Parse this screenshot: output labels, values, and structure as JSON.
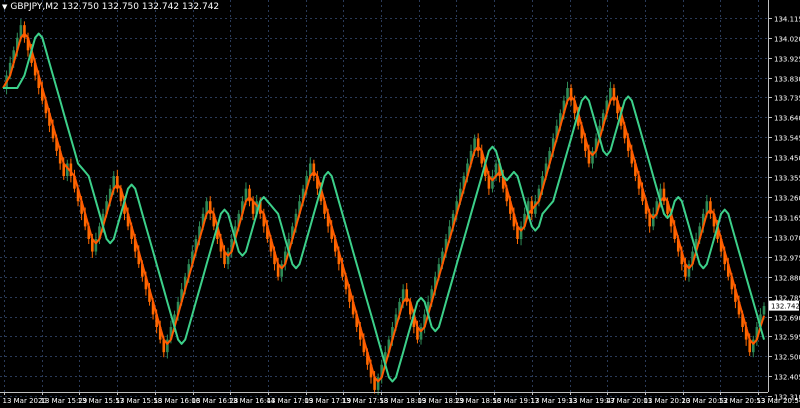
{
  "window": {
    "symbol": "GBPJPY,M2",
    "ohlc": "132.750 132.750 132.742 132.742",
    "menu_icon": "triangle-down-icon"
  },
  "colors": {
    "background": "#000000",
    "grid": "#2a3a58",
    "axis": "#c0c0c0",
    "text": "#ffffff",
    "bull": "#2e8b57",
    "bear": "#ff6a00",
    "fast_line": "#3cd08a",
    "slow_line": "#ff5a00",
    "price_tag_bg": "#ffffff",
    "price_tag_text": "#000000"
  },
  "chart_data": {
    "type": "candlestick",
    "symbol": "GBPJPY",
    "timeframe": "M2",
    "grid": true,
    "ylim": [
      132.33,
      134.2
    ],
    "y_ticks": [
      "134.115",
      "134.020",
      "133.925",
      "133.830",
      "133.735",
      "133.640",
      "133.545",
      "133.450",
      "133.355",
      "133.260",
      "133.165",
      "133.070",
      "132.975",
      "132.880",
      "132.785",
      "132.690",
      "132.595",
      "132.500",
      "132.405",
      "132.310"
    ],
    "x_ticks": [
      "13 Mar 2020",
      "13 Mar 15:29",
      "13 Mar 15:57",
      "13 Mar 15:58",
      "13 Mar 16:06",
      "13 Mar 16:28",
      "13 Mar 16:44",
      "13 Mar 17:09",
      "13 Mar 17:19",
      "13 Mar 17:58",
      "13 Mar 18:09",
      "13 Mar 18:29",
      "13 Mar 18:56",
      "13 Mar 19:17",
      "13 Mar 19:33",
      "13 Mar 19:47",
      "13 Mar 20:01",
      "13 Mar 20:20",
      "13 Mar 20:52",
      "13 Mar 20:53",
      "13 Mar 20:54"
    ],
    "current_price": "132.742",
    "close_series": [
      133.78,
      133.84,
      133.9,
      133.96,
      134.02,
      134.08,
      134.02,
      133.96,
      133.9,
      133.84,
      133.78,
      133.72,
      133.66,
      133.6,
      133.54,
      133.48,
      133.42,
      133.36,
      133.42,
      133.36,
      133.3,
      133.24,
      133.18,
      133.12,
      133.06,
      133.0,
      133.06,
      133.12,
      133.18,
      133.24,
      133.3,
      133.36,
      133.3,
      133.24,
      133.18,
      133.12,
      133.06,
      133.0,
      132.94,
      132.88,
      132.82,
      132.76,
      132.7,
      132.64,
      132.58,
      132.52,
      132.58,
      132.64,
      132.7,
      132.76,
      132.82,
      132.88,
      132.94,
      133.0,
      133.06,
      133.12,
      133.18,
      133.24,
      133.18,
      133.12,
      133.06,
      133.0,
      132.94,
      133.0,
      133.06,
      133.12,
      133.18,
      133.24,
      133.3,
      133.24,
      133.18,
      133.24,
      133.18,
      133.12,
      133.06,
      133.0,
      132.94,
      132.88,
      132.94,
      133.0,
      133.06,
      133.12,
      133.18,
      133.24,
      133.3,
      133.36,
      133.42,
      133.36,
      133.3,
      133.24,
      133.18,
      133.12,
      133.06,
      133.0,
      132.94,
      132.88,
      132.82,
      132.76,
      132.7,
      132.64,
      132.58,
      132.52,
      132.46,
      132.4,
      132.34,
      132.4,
      132.46,
      132.52,
      132.58,
      132.64,
      132.7,
      132.76,
      132.82,
      132.76,
      132.7,
      132.64,
      132.58,
      132.64,
      132.7,
      132.76,
      132.82,
      132.88,
      132.94,
      133.0,
      133.06,
      133.12,
      133.18,
      133.24,
      133.3,
      133.36,
      133.42,
      133.48,
      133.54,
      133.48,
      133.42,
      133.36,
      133.3,
      133.36,
      133.42,
      133.36,
      133.3,
      133.24,
      133.18,
      133.12,
      133.06,
      133.12,
      133.18,
      133.24,
      133.18,
      133.24,
      133.3,
      133.36,
      133.42,
      133.48,
      133.54,
      133.6,
      133.66,
      133.72,
      133.78,
      133.72,
      133.66,
      133.6,
      133.54,
      133.48,
      133.42,
      133.48,
      133.54,
      133.6,
      133.66,
      133.72,
      133.78,
      133.72,
      133.66,
      133.6,
      133.54,
      133.48,
      133.42,
      133.36,
      133.3,
      133.24,
      133.18,
      133.12,
      133.18,
      133.24,
      133.3,
      133.24,
      133.18,
      133.12,
      133.06,
      133.0,
      132.94,
      132.88,
      132.94,
      133.0,
      133.06,
      133.12,
      133.18,
      133.24,
      133.18,
      133.12,
      133.06,
      133.0,
      132.94,
      132.88,
      132.82,
      132.76,
      132.7,
      132.64,
      132.58,
      132.52,
      132.58,
      132.64,
      132.7,
      132.74
    ]
  }
}
